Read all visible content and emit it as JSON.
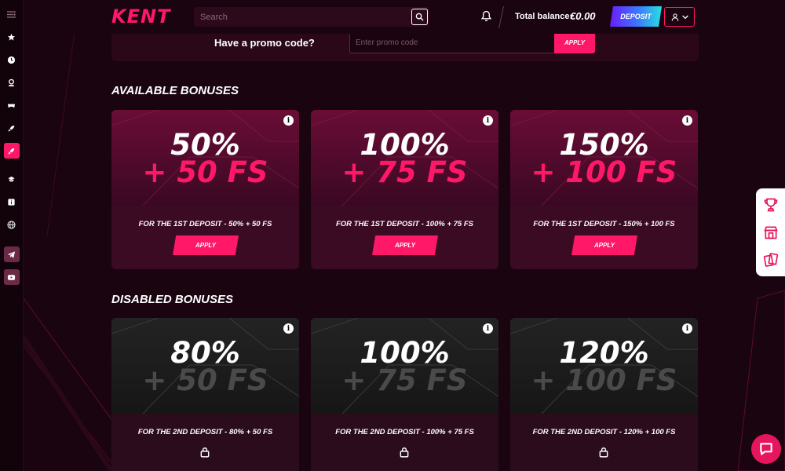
{
  "header": {
    "logo": "KENT",
    "search_placeholder": "Search",
    "balance_label": "Total balance:",
    "balance_value": "€0.00",
    "deposit_label": "DEPOSIT"
  },
  "sidebar": {
    "items": [
      {
        "icon": "menu-icon"
      },
      {
        "icon": "star-icon"
      },
      {
        "icon": "clock-icon"
      },
      {
        "icon": "user-badge-icon"
      },
      {
        "icon": "gamepad-icon"
      },
      {
        "icon": "rocket-icon"
      },
      {
        "icon": "gift-icon",
        "active": true
      },
      {
        "icon": "ticket-icon"
      },
      {
        "icon": "info-icon"
      },
      {
        "icon": "globe-icon"
      },
      {
        "icon": "telegram-icon"
      },
      {
        "icon": "youtube-icon"
      }
    ]
  },
  "promo": {
    "label": "Have a promo code?",
    "placeholder": "Enter promo code",
    "apply_label": "APPLY"
  },
  "available": {
    "title": "AVAILABLE BONUSES",
    "cards": [
      {
        "percent": "50%",
        "fs": "+ 50 FS",
        "desc": "FOR THE 1ST DEPOSIT - 50% + 50 FS",
        "apply": "APPLY"
      },
      {
        "percent": "100%",
        "fs": "+ 75 FS",
        "desc": "FOR THE 1ST DEPOSIT - 100% + 75 FS",
        "apply": "APPLY"
      },
      {
        "percent": "150%",
        "fs": "+ 100 FS",
        "desc": "FOR THE 1ST DEPOSIT - 150% + 100 FS",
        "apply": "APPLY"
      }
    ]
  },
  "disabled": {
    "title": "DISABLED BONUSES",
    "cards": [
      {
        "percent": "80%",
        "fs": "+ 50 FS",
        "desc": "FOR THE 2ND DEPOSIT - 80% + 50 FS"
      },
      {
        "percent": "100%",
        "fs": "+ 75 FS",
        "desc": "FOR THE 2ND DEPOSIT - 100% + 75 FS"
      },
      {
        "percent": "120%",
        "fs": "+ 100 FS",
        "desc": "FOR THE 2ND DEPOSIT - 120% + 100 FS"
      }
    ]
  },
  "float_panel": {
    "items": [
      {
        "icon": "trophy-icon"
      },
      {
        "icon": "shop-icon"
      },
      {
        "icon": "cards-icon"
      }
    ]
  },
  "colors": {
    "accent": "#ff1768",
    "background": "#1a0410"
  }
}
